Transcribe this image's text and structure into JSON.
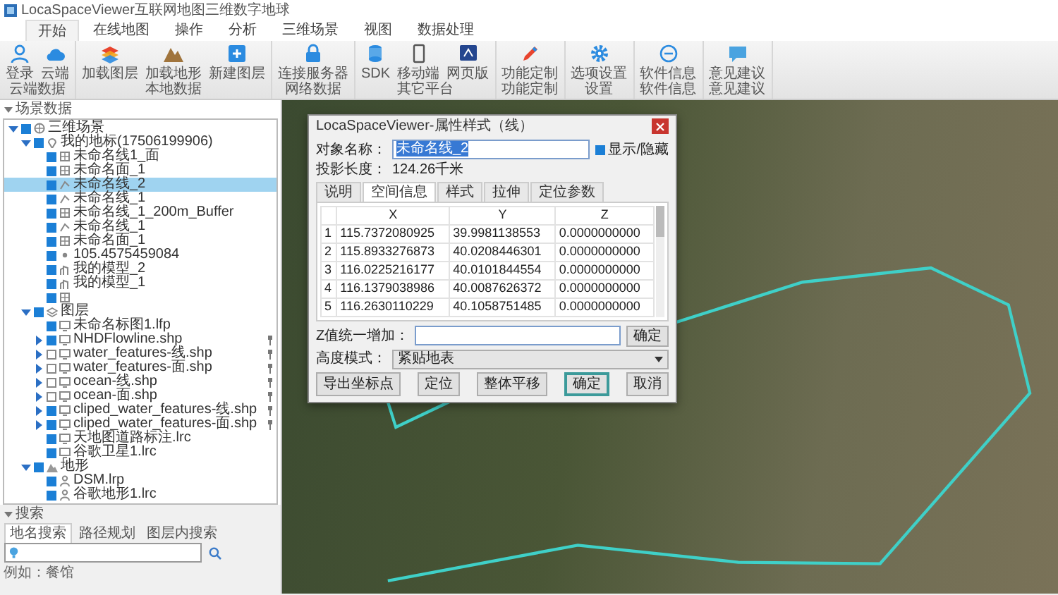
{
  "window": {
    "title": "LocaSpaceViewer互联网地图三维数字地球"
  },
  "ribbon_tabs": [
    {
      "label": "开始",
      "selected": true
    },
    {
      "label": "在线地图",
      "selected": false
    },
    {
      "label": "操作",
      "selected": false
    },
    {
      "label": "分析",
      "selected": false
    },
    {
      "label": "三维场景",
      "selected": false
    },
    {
      "label": "视图",
      "selected": false
    },
    {
      "label": "数据处理",
      "selected": false
    }
  ],
  "ribbon_groups": [
    {
      "label": "云端数据",
      "buttons": [
        {
          "label": "登录"
        },
        {
          "label": "云端"
        }
      ]
    },
    {
      "label": "本地数据",
      "buttons": [
        {
          "label": "加载图层"
        },
        {
          "label": "加载地形"
        },
        {
          "label": "新建图层"
        }
      ]
    },
    {
      "label": "网络数据",
      "buttons": [
        {
          "label": "连接服务器"
        }
      ]
    },
    {
      "label": "其它平台",
      "buttons": [
        {
          "label": "SDK"
        },
        {
          "label": "移动端"
        },
        {
          "label": "网页版"
        }
      ]
    },
    {
      "label": "功能定制",
      "buttons": [
        {
          "label": "功能定制"
        }
      ]
    },
    {
      "label": "设置",
      "buttons": [
        {
          "label": "选项设置"
        }
      ]
    },
    {
      "label": "软件信息",
      "buttons": [
        {
          "label": "软件信息"
        }
      ]
    },
    {
      "label": "意见建议",
      "buttons": [
        {
          "label": "意见建议"
        }
      ]
    }
  ],
  "scene_panel": {
    "title": "场景数据",
    "tree": [
      {
        "label": "三维场景",
        "kind": "scene",
        "checked": true,
        "selected": false,
        "expanded": true,
        "children": [
          {
            "label": "我的地标(17506199906)",
            "kind": "folder",
            "checked": true,
            "selected": false,
            "expanded": true,
            "children": [
              {
                "label": "未命名线1_面",
                "kind": "area",
                "checked": true,
                "selected": false
              },
              {
                "label": "未命名面_1",
                "kind": "area",
                "checked": true,
                "selected": false
              },
              {
                "label": "未命名线_2",
                "kind": "line",
                "checked": true,
                "selected": true
              },
              {
                "label": "未命名线_1",
                "kind": "line",
                "checked": true,
                "selected": false
              },
              {
                "label": "未命名线_1_200m_Buffer",
                "kind": "area",
                "checked": true,
                "selected": false
              },
              {
                "label": "未命名线_1",
                "kind": "line",
                "checked": true,
                "selected": false
              },
              {
                "label": "未命名面_1",
                "kind": "area",
                "checked": true,
                "selected": false
              },
              {
                "label": "105.4575459084",
                "kind": "point",
                "checked": true,
                "selected": false
              },
              {
                "label": "我的模型_2",
                "kind": "model",
                "checked": true,
                "selected": false
              },
              {
                "label": "我的模型_1",
                "kind": "model",
                "checked": true,
                "selected": false
              },
              {
                "kind": "area",
                "checked": true,
                "selected": false
              }
            ]
          },
          {
            "label": "图层",
            "kind": "layers",
            "checked": true,
            "selected": false,
            "expanded": true,
            "children": [
              {
                "label": "未命名标图1.lfp",
                "kind": "file",
                "checked": true,
                "selected": false
              },
              {
                "label": "NHDFlowline.shp",
                "kind": "file",
                "checked": true,
                "selected": false,
                "expanded": false,
                "pinned": true
              },
              {
                "label": "water_features-线.shp",
                "kind": "file",
                "checked": false,
                "selected": false,
                "expanded": false,
                "pinned": true
              },
              {
                "label": "water_features-面.shp",
                "kind": "file",
                "checked": false,
                "selected": false,
                "expanded": false,
                "pinned": true
              },
              {
                "label": "ocean-线.shp",
                "kind": "file",
                "checked": false,
                "selected": false,
                "expanded": false,
                "pinned": true
              },
              {
                "label": "ocean-面.shp",
                "kind": "file",
                "checked": false,
                "selected": false,
                "expanded": false,
                "pinned": true
              },
              {
                "label": "cliped_water_features-线.shp",
                "kind": "file",
                "checked": true,
                "selected": false,
                "expanded": false,
                "pinned": true
              },
              {
                "label": "cliped_water_features-面.shp",
                "kind": "file",
                "checked": true,
                "selected": false,
                "expanded": false,
                "pinned": true
              },
              {
                "label": "天地图道路标注.lrc",
                "kind": "file",
                "checked": true,
                "selected": false
              },
              {
                "label": "谷歌卫星1.lrc",
                "kind": "file",
                "checked": true,
                "selected": false
              }
            ]
          },
          {
            "label": "地形",
            "kind": "terrain",
            "checked": true,
            "selected": false,
            "expanded": true,
            "children": [
              {
                "label": "DSM.lrp",
                "kind": "dem",
                "checked": true,
                "selected": false
              },
              {
                "label": "谷歌地形1.lrc",
                "kind": "dem",
                "checked": true,
                "selected": false
              }
            ]
          }
        ]
      }
    ]
  },
  "search_panel": {
    "title": "搜索",
    "tabs": [
      {
        "label": "地名搜索",
        "selected": true
      },
      {
        "label": "路径规划",
        "selected": false
      },
      {
        "label": "图层内搜索",
        "selected": false
      }
    ],
    "hint": "例如：餐馆"
  },
  "dialog": {
    "title": "LocaSpaceViewer-属性样式（线）",
    "name_label": "对象名称：",
    "name_value": "未命名线_2",
    "visible_label": "显示/隐藏",
    "visible_checked": true,
    "length_label": "投影长度：",
    "length_value": "124.26千米",
    "tabs": [
      {
        "label": "说明",
        "selected": false
      },
      {
        "label": "空间信息",
        "selected": true
      },
      {
        "label": "样式",
        "selected": false
      },
      {
        "label": "拉伸",
        "selected": false
      },
      {
        "label": "定位参数",
        "selected": false
      }
    ],
    "table": {
      "columns": [
        "",
        "X",
        "Y",
        "Z"
      ],
      "rows": [
        [
          "1",
          "115.7372080925",
          "39.9981138553",
          "0.0000000000"
        ],
        [
          "2",
          "115.8933276873",
          "40.0208446301",
          "0.0000000000"
        ],
        [
          "3",
          "116.0225216177",
          "40.0101844554",
          "0.0000000000"
        ],
        [
          "4",
          "116.1379038986",
          "40.0087626372",
          "0.0000000000"
        ],
        [
          "5",
          "116.2630110229",
          "40.1058751485",
          "0.0000000000"
        ]
      ]
    },
    "z_label": "Z值统一增加：",
    "z_button": "确定",
    "height_label": "高度模式：",
    "height_value": "紧贴地表",
    "buttons": [
      {
        "label": "导出坐标点",
        "focused": false
      },
      {
        "label": "定位",
        "focused": false
      },
      {
        "label": "整体平移",
        "focused": false
      },
      {
        "label": "确定",
        "focused": true
      },
      {
        "label": "取消",
        "focused": false
      }
    ]
  }
}
